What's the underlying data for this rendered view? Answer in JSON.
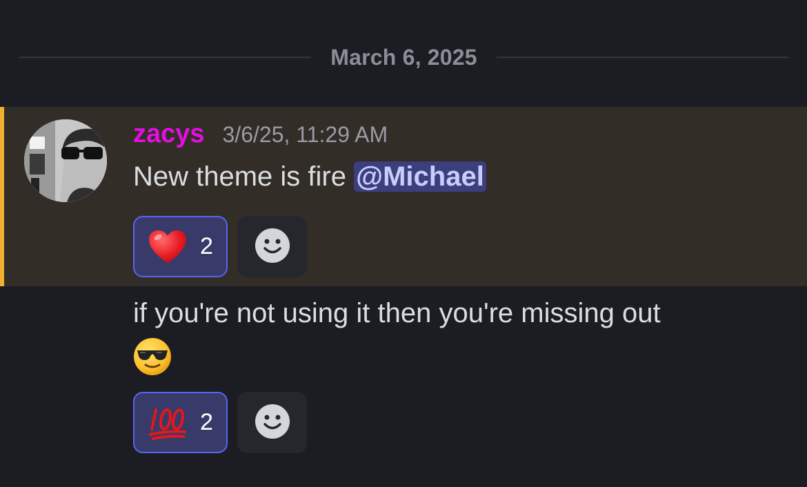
{
  "date_divider": {
    "label": "March 6, 2025"
  },
  "colors": {
    "background": "#1c1d22",
    "highlight_background": "#332d28",
    "highlight_accent": "#f0b132",
    "username": "#e30fe0",
    "mention_bg": "#3c3f7e",
    "reaction_active_border": "#5865f2"
  },
  "message1": {
    "author": "zacys",
    "timestamp": "3/6/25, 11:29 AM",
    "text": "New theme is fire ",
    "mention": "@Michael",
    "reactions": [
      {
        "emoji": "red-heart",
        "count": "2"
      }
    ],
    "add_reaction_icon": "smiley-add-reaction-icon"
  },
  "message2": {
    "text": "if you're not using it then you're missing out",
    "trailing_emoji": "smiling-face-with-sunglasses",
    "reactions": [
      {
        "emoji": "hundred-points",
        "count": "2"
      }
    ],
    "add_reaction_icon": "smiley-add-reaction-icon"
  }
}
